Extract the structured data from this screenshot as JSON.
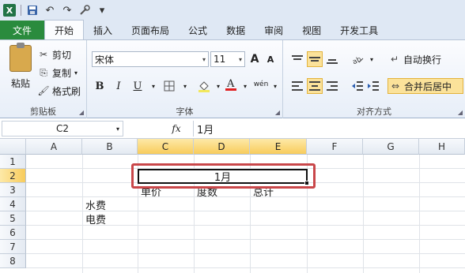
{
  "qat": {
    "app_icon": "X",
    "undo_label": "↶",
    "redo_label": "↷",
    "customize_label": "▾"
  },
  "tabs": [
    "文件",
    "开始",
    "插入",
    "页面布局",
    "公式",
    "数据",
    "审阅",
    "视图",
    "开发工具"
  ],
  "ribbon": {
    "clipboard": {
      "paste": "粘贴",
      "cut": "剪切",
      "copy": "复制",
      "format_painter": "格式刷",
      "label": "剪贴板"
    },
    "font": {
      "name": "宋体",
      "size": "11",
      "grow": "A",
      "shrink": "A",
      "bold": "B",
      "italic": "I",
      "underline": "U",
      "label": "字体",
      "phonetic": "wén"
    },
    "alignment": {
      "wrap_text": "自动换行",
      "merge_center": "合并后居中",
      "label": "对齐方式"
    }
  },
  "formula_bar": {
    "name_box": "C2",
    "fx": "fx",
    "content": "1月"
  },
  "sheet": {
    "columns": [
      "A",
      "B",
      "C",
      "D",
      "E",
      "F",
      "G",
      "H"
    ],
    "rows": [
      "1",
      "2",
      "3",
      "4",
      "5",
      "6",
      "7",
      "8"
    ],
    "merged_cell": "1月",
    "row3": {
      "c": "单价",
      "d": "度数",
      "e": "总计"
    },
    "b4": "水费",
    "b5": "电费"
  },
  "colors": {
    "file_tab": "#2a8b3d",
    "selection_header": "#f8cc5c",
    "highlight_box": "#c9474a"
  }
}
